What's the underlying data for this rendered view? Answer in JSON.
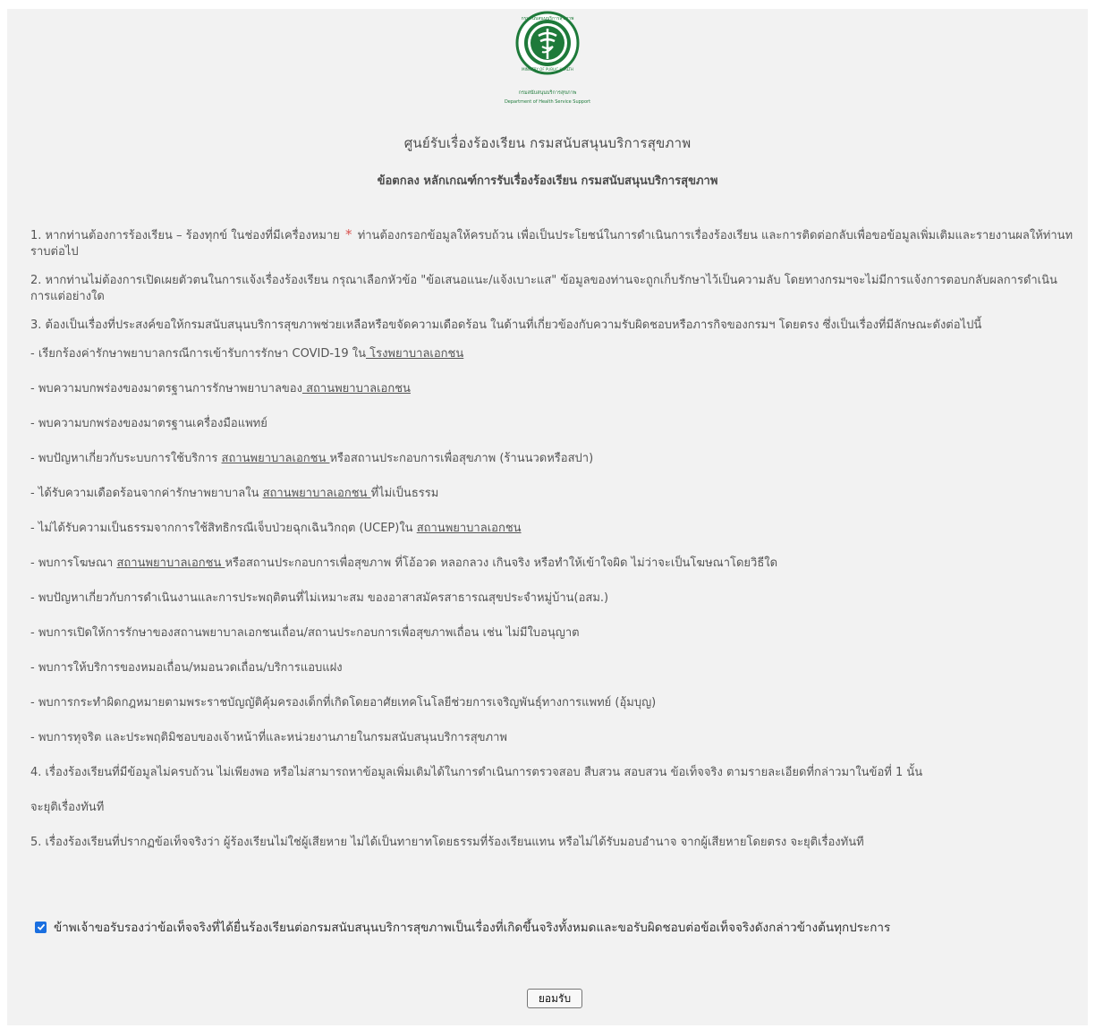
{
  "logo": {
    "seal_text": "กรมสนับสนุนบริการสุขภาพ",
    "seal_text_en": "MINISTRY OF PUBLIC HEALTH",
    "org_th": "กรมสนับสนุนบริการสุขภาพ",
    "org_en": "Department of Health Service Support"
  },
  "title": "ศูนย์รับเรื่องร้องเรียน กรมสนับสนุนบริการสุขภาพ",
  "subtitle": "ข้อตกลง หลักเกณฑ์การรับเรื่องร้องเรียน กรมสนับสนุนบริการสุขภาพ",
  "terms": {
    "t1_before": "1. หากท่านต้องการร้องเรียน – ร้องทุกข์ ในช่องที่มีเครื่องหมาย",
    "t1_star": "*",
    "t1_after": "ท่านต้องกรอกข้อมูลให้ครบถ้วน เพื่อเป็นประโยชน์ในการดำเนินการเรื่องร้องเรียน และการติดต่อกลับเพื่อขอข้อมูลเพิ่มเติมและรายงานผลให้ท่านทราบต่อไป",
    "t2": "2. หากท่านไม่ต้องการเปิดเผยตัวตนในการแจ้งเรื่องร้องเรียน กรุณาเลือกหัวข้อ \"ข้อเสนอแนะ/แจ้งเบาะแส\" ข้อมูลของท่านจะถูกเก็บรักษาไว้เป็นความลับ โดยทางกรมฯจะไม่มีการแจ้งการตอบกลับผลการดำเนินการแต่อย่างใด",
    "t3": "3. ต้องเป็นเรื่องที่ประสงค์ขอให้กรมสนับสนุนบริการสุขภาพช่วยเหลือหรือขจัดความเดือดร้อน ในด้านที่เกี่ยวข้องกับความรับผิดชอบหรือภารกิจของกรมฯ โดยตรง ซึ่งเป็นเรื่องที่มีลักษณะดังต่อไปนี้",
    "items": [
      {
        "a": "- เรียกร้องค่ารักษาพยาบาลกรณีการเข้ารับการรักษา COVID-19 ใน",
        "u": " โรงพยาบาลเอกชน",
        "b": ""
      },
      {
        "a": "- พบความบกพร่องของมาตรฐานการรักษาพยาบาลของ",
        "u": " สถานพยาบาลเอกชน",
        "b": ""
      },
      {
        "a": "- พบความบกพร่องของมาตรฐานเครื่องมือแพทย์",
        "u": "",
        "b": ""
      },
      {
        "a": "- พบปัญหาเกี่ยวกับระบบการใช้บริการ ",
        "u": " สถานพยาบาลเอกชน ",
        "b": "หรือสถานประกอบการเพื่อสุขภาพ (ร้านนวดหรือสปา)"
      },
      {
        "a": "- ได้รับความเดือดร้อนจากค่ารักษาพยาบาลใน ",
        "u": " สถานพยาบาลเอกชน ",
        "b": "ที่ไม่เป็นธรรม"
      },
      {
        "a": "- ไม่ได้รับความเป็นธรรมจากการใช้สิทธิกรณีเจ็บป่วยฉุกเฉินวิกฤต (UCEP)ใน ",
        "u": " สถานพยาบาลเอกชน",
        "b": ""
      },
      {
        "a": "- พบการโฆษณา ",
        "u": " สถานพยาบาลเอกชน ",
        "b": "หรือสถานประกอบการเพื่อสุขภาพ ที่โอ้อวด หลอกลวง เกินจริง หรือทำให้เข้าใจผิด ไม่ว่าจะเป็นโฆษณาโดยวิธีใด"
      },
      {
        "a": "- พบปัญหาเกี่ยวกับการดำเนินงานและการประพฤติตนที่ไม่เหมาะสม ของอาสาสมัครสาธารณสุขประจำหมู่บ้าน(อสม.)",
        "u": "",
        "b": ""
      },
      {
        "a": "- พบการเปิดให้การรักษาของสถานพยาบาลเอกชนเถื่อน/สถานประกอบการเพื่อสุขภาพเถื่อน เช่น ไม่มีใบอนุญาต",
        "u": "",
        "b": ""
      },
      {
        "a": "- พบการให้บริการของหมอเถื่อน/หมอนวดเถื่อน/บริการแอบแฝง",
        "u": "",
        "b": ""
      },
      {
        "a": "- พบการกระทำผิดกฎหมายตามพระราชบัญญัติคุ้มครองเด็กที่เกิดโดยอาศัยเทคโนโลยีช่วยการเจริญพันธุ์ทางการแพทย์ (อุ้มบุญ)",
        "u": "",
        "b": ""
      },
      {
        "a": "- พบการทุจริต และประพฤติมิชอบของเจ้าหน้าที่และหน่วยงานภายในกรมสนับสนุนบริการสุขภาพ",
        "u": "",
        "b": ""
      }
    ],
    "t4": "4. เรื่องร้องเรียนที่มีข้อมูลไม่ครบถ้วน ไม่เพียงพอ หรือไม่สามารถหาข้อมูลเพิ่มเติมได้ในการดำเนินการตรวจสอบ สืบสวน สอบสวน ข้อเท็จจริง ตามรายละเอียดที่กล่าวมาในข้อที่ 1 นั้น",
    "t4b": "จะยุติเรื่องทันที",
    "t5": "5. เรื่องร้องเรียนที่ปรากฏข้อเท็จจริงว่า ผู้ร้องเรียนไม่ใช่ผู้เสียหาย ไม่ได้เป็นทายาทโดยธรรมที่ร้องเรียนแทน หรือไม่ได้รับมอบอำนาจ จากผู้เสียหายโดยตรง จะยุติเรื่องทันที"
  },
  "acknowledge": {
    "checked": true,
    "label": "ข้าพเจ้าขอรับรองว่าข้อเท็จจริงที่ได้ยื่นร้องเรียนต่อกรมสนับสนุนบริการสุขภาพเป็นเรื่องที่เกิดขึ้นจริงทั้งหมดและขอรับผิดชอบต่อข้อเท็จจริงดังกล่าวข้างต้นทุกประการ"
  },
  "accept_button": "ยอมรับ",
  "colors": {
    "panel_bg": "#f2f2f2",
    "text": "#555555",
    "required_star": "#d9534f",
    "logo_green": "#1e7a3a",
    "checkbox": "#1a6fe0"
  },
  "icons": {
    "logo": "ministry-of-public-health-seal",
    "checkbox": "checkmark-icon"
  }
}
